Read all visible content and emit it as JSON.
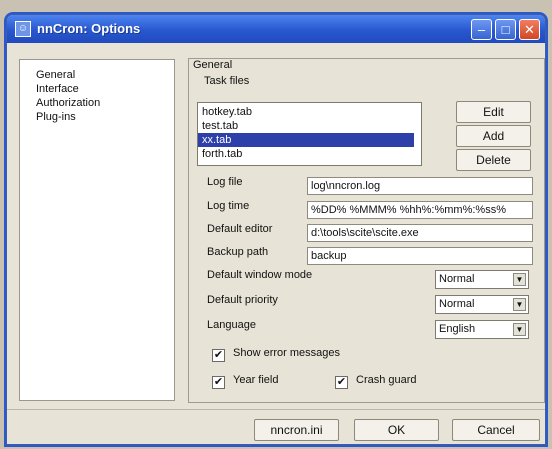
{
  "window": {
    "title": "nnCron: Options"
  },
  "nav": {
    "items": [
      "General",
      "Interface",
      "Authorization",
      "Plug-ins"
    ]
  },
  "panel": {
    "group_label": "General",
    "task_files_label": "Task files",
    "task_files": [
      "hotkey.tab",
      "test.tab",
      "xx.tab",
      "forth.tab"
    ],
    "selected_index": 2,
    "buttons": {
      "edit": "Edit",
      "add": "Add",
      "delete": "Delete"
    },
    "fields": [
      {
        "label": "Log file",
        "value": "log\\nncron.log"
      },
      {
        "label": "Log time",
        "value": "%DD% %MMM% %hh%:%mm%:%ss%"
      },
      {
        "label": "Default editor",
        "value": "d:\\tools\\scite\\scite.exe"
      },
      {
        "label": "Backup path",
        "value": "backup"
      }
    ],
    "selects": [
      {
        "label": "Default window mode",
        "value": "Normal"
      },
      {
        "label": "Default priority",
        "value": "Normal"
      },
      {
        "label": "Language",
        "value": "English"
      }
    ],
    "checks": {
      "show_errors": "Show error messages",
      "year_field": "Year field",
      "crash_guard": "Crash guard"
    }
  },
  "footer": {
    "ini": "nncron.ini",
    "ok": "OK",
    "cancel": "Cancel"
  },
  "icons": {
    "app": "app-icon",
    "minimize": "minimize-icon",
    "maximize": "maximize-icon",
    "close": "close-icon",
    "dropdown": "dropdown-arrow-icon",
    "check": "checkmark-icon"
  },
  "colors": {
    "titlebar": "#2857cf",
    "selection": "#2d3fa8",
    "dialog_bg": "#e7e3d6"
  }
}
